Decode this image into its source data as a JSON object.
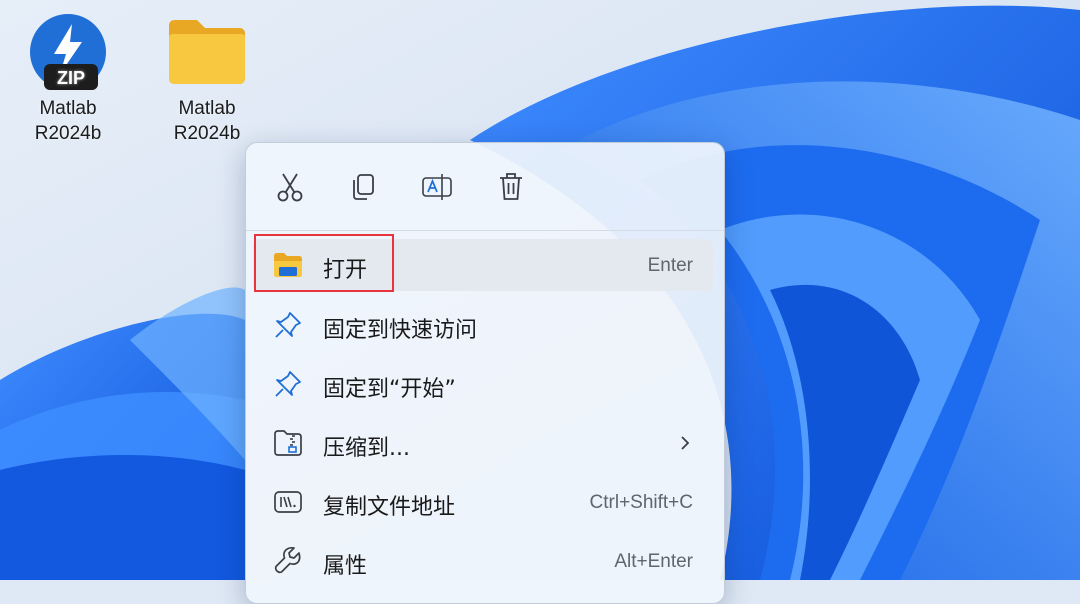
{
  "desktop": {
    "icons": [
      {
        "label_line1": "Matlab",
        "label_line2": "R2024b",
        "icon": "zip-archive-icon",
        "badge": "ZIP"
      },
      {
        "label_line1": "Matlab",
        "label_line2": "R2024b",
        "icon": "folder-icon"
      }
    ]
  },
  "context_menu": {
    "quick_actions": [
      {
        "icon": "cut-icon"
      },
      {
        "icon": "copy-icon"
      },
      {
        "icon": "rename-icon"
      },
      {
        "icon": "delete-icon"
      }
    ],
    "items": [
      {
        "label": "打开",
        "shortcut": "Enter",
        "icon": "folder-open-icon"
      },
      {
        "label": "固定到快速访问",
        "icon": "pin-icon"
      },
      {
        "label": "固定到“开始”",
        "icon": "pin-icon"
      },
      {
        "label": "压缩到...",
        "icon": "zip-folder-icon",
        "submenu_arrow": "›"
      },
      {
        "label": "复制文件地址",
        "shortcut": "Ctrl+Shift+C",
        "icon": "copy-path-icon"
      },
      {
        "label": "属性",
        "shortcut": "Alt+Enter",
        "icon": "wrench-icon"
      }
    ]
  },
  "colors": {
    "wallpaper_bg": "#dfe9f5",
    "bloom_blue": "#1a73f0",
    "highlight": "#e8353d",
    "folder_yellow": "#f8c840",
    "accent_blue": "#1f6fd6"
  }
}
